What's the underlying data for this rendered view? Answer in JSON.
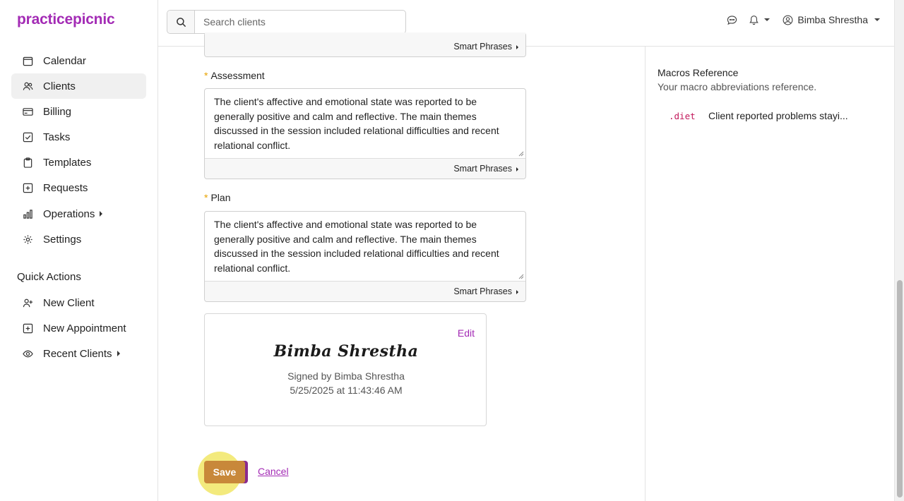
{
  "brand": "practicepicnic",
  "nav": [
    {
      "label": "Calendar",
      "icon": "calendar-icon"
    },
    {
      "label": "Clients",
      "icon": "users-icon"
    },
    {
      "label": "Billing",
      "icon": "credit-card-icon"
    },
    {
      "label": "Tasks",
      "icon": "checkbox-icon"
    },
    {
      "label": "Templates",
      "icon": "clipboard-icon"
    },
    {
      "label": "Requests",
      "icon": "plus-square-icon"
    },
    {
      "label": "Operations",
      "icon": "bar-chart-icon"
    },
    {
      "label": "Settings",
      "icon": "gear-icon"
    }
  ],
  "quick_actions": {
    "title": "Quick Actions",
    "items": [
      {
        "label": "New Client",
        "icon": "user-plus-icon"
      },
      {
        "label": "New Appointment",
        "icon": "plus-square-icon"
      },
      {
        "label": "Recent Clients",
        "icon": "eye-icon"
      }
    ]
  },
  "topbar": {
    "search_placeholder": "Search clients",
    "user_name": "Bimba Shrestha"
  },
  "form": {
    "smart_phrases_label": "Smart Phrases",
    "assessment": {
      "label": "Assessment",
      "text": "The client's affective and emotional state was reported to be generally positive and calm and reflective. The main themes discussed in the session included relational difficulties and recent relational conflict."
    },
    "plan": {
      "label": "Plan",
      "text": "The client's affective and emotional state was reported to be generally positive and calm and reflective. The main themes discussed in the session included relational difficulties and recent relational conflict."
    },
    "signature": {
      "edit_label": "Edit",
      "script_name": "Bimba Shrestha",
      "signed_by": "Signed by Bimba Shrestha",
      "signed_at": "5/25/2025 at 11:43:46 AM"
    },
    "save_label": "Save",
    "cancel_label": "Cancel"
  },
  "macros": {
    "title": "Macros Reference",
    "subtitle": "Your macro abbreviations reference.",
    "items": [
      {
        "abbr": ".diet",
        "text": "Client reported problems stayi..."
      }
    ]
  },
  "colors": {
    "brand": "#a32bb5",
    "save_button": "#c8883a",
    "highlight": "#f3ea7d",
    "required_marker": "#e8a200",
    "macro_abbr": "#c2185b"
  }
}
